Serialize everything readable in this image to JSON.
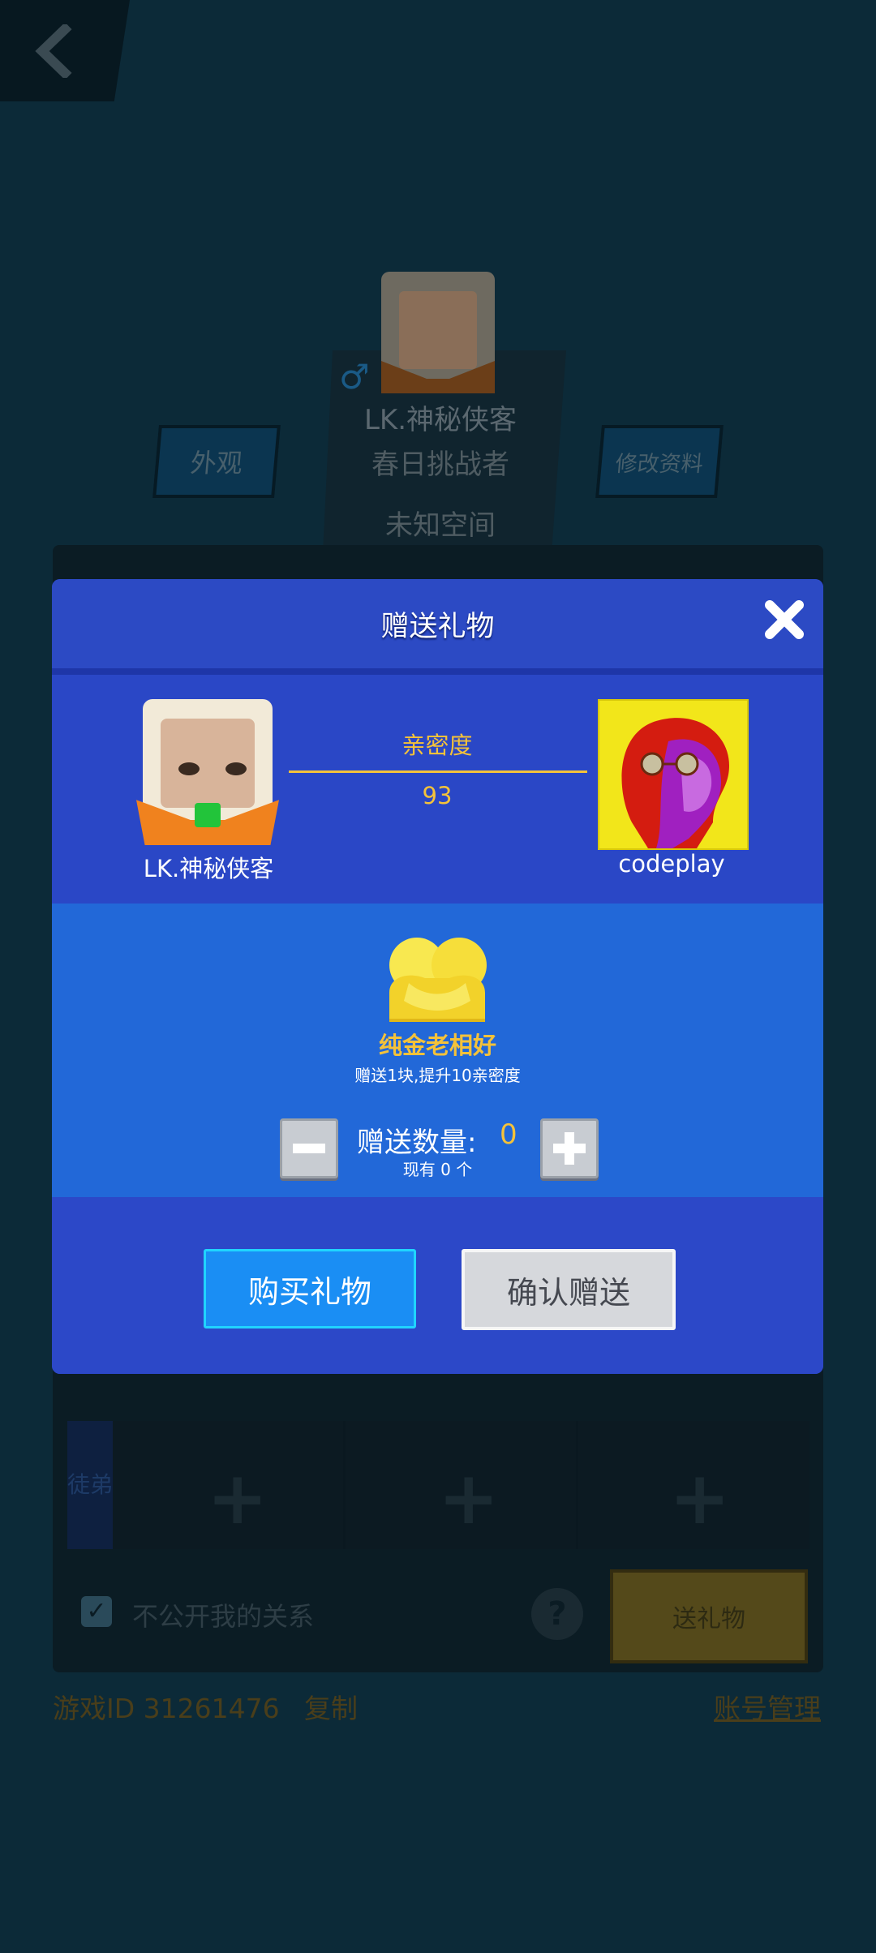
{
  "profile": {
    "nickname": "LK.神秘侠客",
    "title": "春日挑战者",
    "location": "未知空间",
    "gender_icon": "male-icon",
    "look_label": "外观",
    "edit_label": "修改资料",
    "slot_side_label": "徒弟",
    "privacy_label": "不公开我的关系",
    "send_gift_label": "送礼物",
    "game_id": "游戏ID 31261476",
    "copy_label": "复制",
    "account_label": "账号管理"
  },
  "modal": {
    "title": "赠送礼物",
    "sender_name": "LK.神秘侠客",
    "receiver_name": "codeplay",
    "intimacy_label": "亲密度",
    "intimacy_value": "93",
    "gift_name": "纯金老相好",
    "gift_desc": "赠送1块,提升10亲密度",
    "quantity_label": "赠送数量:",
    "quantity_value": "0",
    "owned_text": "现有 0 个",
    "buy_label": "购买礼物",
    "confirm_label": "确认赠送"
  },
  "colors": {
    "modal_bg": "#2c48c8",
    "gift_section_bg": "#2268d8",
    "accent_gold": "#f4c23a",
    "buy_button": "#1a8ef4",
    "confirm_button": "#d6d8dc"
  }
}
